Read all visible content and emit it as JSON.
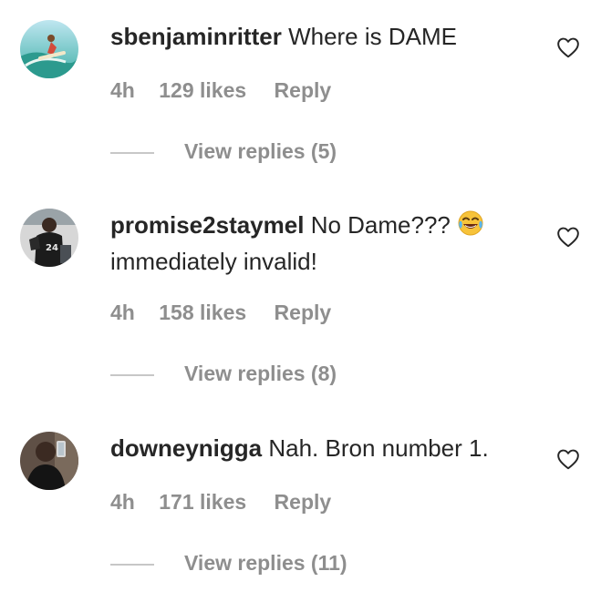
{
  "comments": [
    {
      "username": "sbenjaminritter",
      "text": "Where is DAME",
      "text_line2": "",
      "time": "4h",
      "likes": "129 likes",
      "reply": "Reply",
      "view_replies": "View replies (5)",
      "avatar_icon": "surfer-avatar-icon"
    },
    {
      "username": "promise2staymel",
      "text": "No Dame???",
      "emoji": "laughing-crying-emoji",
      "text_line2": "immediately invalid!",
      "time": "4h",
      "likes": "158 likes",
      "reply": "Reply",
      "view_replies": "View replies (8)",
      "avatar_icon": "basketball-player-avatar-icon"
    },
    {
      "username": "downeynigga",
      "text": "Nah. Bron number 1.",
      "text_line2": "",
      "time": "4h",
      "likes": "171 likes",
      "reply": "Reply",
      "view_replies": "View replies (11)",
      "avatar_icon": "selfie-avatar-icon"
    }
  ],
  "colors": {
    "text": "#262626",
    "meta": "#8e8e8e",
    "divider": "#c7c7c7",
    "background": "#ffffff"
  }
}
